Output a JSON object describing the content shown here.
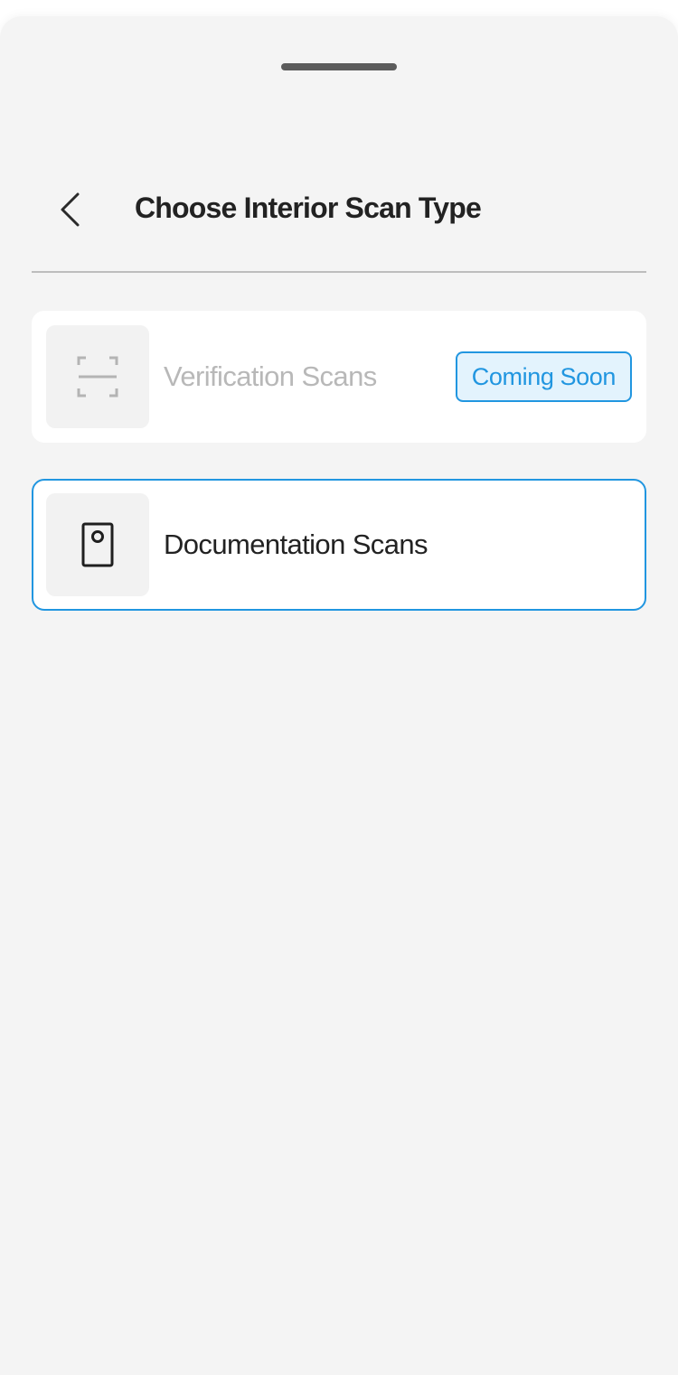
{
  "header": {
    "title": "Choose Interior Scan Type",
    "back_icon": "chevron-left-icon"
  },
  "options": [
    {
      "label": "Verification Scans",
      "icon": "scan-frame-icon",
      "badge": "Coming Soon",
      "enabled": false
    },
    {
      "label": "Documentation Scans",
      "icon": "document-icon",
      "selected": true
    }
  ],
  "colors": {
    "accent": "#2196e0",
    "background": "#f4f4f4",
    "card": "#ffffff",
    "disabled_text": "#b8b8b8",
    "text": "#222222"
  }
}
